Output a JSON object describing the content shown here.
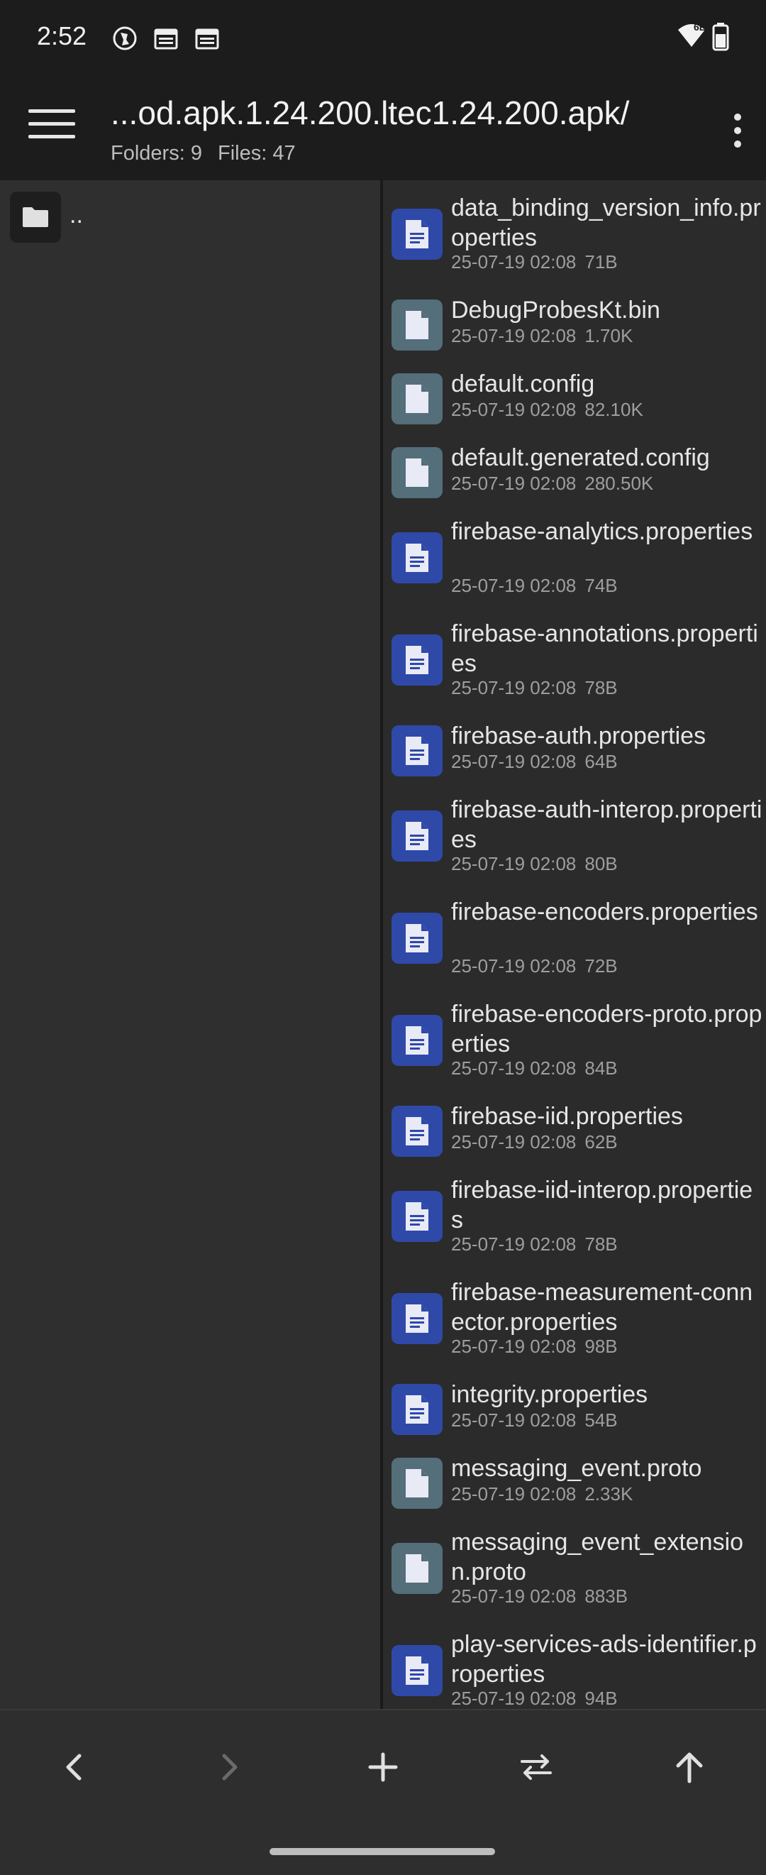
{
  "status_bar": {
    "time": "2:52",
    "icons": [
      "vpn-globe-icon",
      "calendar-icon",
      "calendar-icon"
    ],
    "right_icons": [
      "wifi-icon",
      "battery-icon"
    ],
    "network_label": "6E"
  },
  "app_bar": {
    "title": "...od.apk.1.24.200.ltec1.24.200.apk/",
    "folders_label": "Folders: 9",
    "files_label": "Files: 47"
  },
  "left_pane": {
    "parent_label": ".."
  },
  "files": [
    {
      "name": "data_binding_version_info.properties",
      "date": "25-07-19 02:08",
      "size": "71B",
      "icon": "text-file-icon",
      "color": "#2f49a8"
    },
    {
      "name": "DebugProbesKt.bin",
      "date": "25-07-19 02:08",
      "size": "1.70K",
      "icon": "generic-file-icon",
      "color": "#546e7a"
    },
    {
      "name": "default.config",
      "date": "25-07-19 02:08",
      "size": "82.10K",
      "icon": "generic-file-icon",
      "color": "#546e7a"
    },
    {
      "name": "default.generated.config",
      "date": "25-07-19 02:08",
      "size": "280.50K",
      "icon": "generic-file-icon",
      "color": "#546e7a"
    },
    {
      "name": "firebase-analytics.properties",
      "date": "25-07-19 02:08",
      "size": "74B",
      "icon": "text-file-icon",
      "color": "#2f49a8"
    },
    {
      "name": "firebase-annotations.properties",
      "date": "25-07-19 02:08",
      "size": "78B",
      "icon": "text-file-icon",
      "color": "#2f49a8"
    },
    {
      "name": "firebase-auth.properties",
      "date": "25-07-19 02:08",
      "size": "64B",
      "icon": "text-file-icon",
      "color": "#2f49a8"
    },
    {
      "name": "firebase-auth-interop.properties",
      "date": "25-07-19 02:08",
      "size": "80B",
      "icon": "text-file-icon",
      "color": "#2f49a8"
    },
    {
      "name": "firebase-encoders.properties",
      "date": "25-07-19 02:08",
      "size": "72B",
      "icon": "text-file-icon",
      "color": "#2f49a8"
    },
    {
      "name": "firebase-encoders-proto.properties",
      "date": "25-07-19 02:08",
      "size": "84B",
      "icon": "text-file-icon",
      "color": "#2f49a8"
    },
    {
      "name": "firebase-iid.properties",
      "date": "25-07-19 02:08",
      "size": "62B",
      "icon": "text-file-icon",
      "color": "#2f49a8"
    },
    {
      "name": "firebase-iid-interop.properties",
      "date": "25-07-19 02:08",
      "size": "78B",
      "icon": "text-file-icon",
      "color": "#2f49a8"
    },
    {
      "name": "firebase-measurement-connector.properties",
      "date": "25-07-19 02:08",
      "size": "98B",
      "icon": "text-file-icon",
      "color": "#2f49a8"
    },
    {
      "name": "integrity.properties",
      "date": "25-07-19 02:08",
      "size": "54B",
      "icon": "text-file-icon",
      "color": "#2f49a8"
    },
    {
      "name": "messaging_event.proto",
      "date": "25-07-19 02:08",
      "size": "2.33K",
      "icon": "generic-file-icon",
      "color": "#546e7a"
    },
    {
      "name": "messaging_event_extension.proto",
      "date": "25-07-19 02:08",
      "size": "883B",
      "icon": "generic-file-icon",
      "color": "#546e7a"
    },
    {
      "name": "play-services-ads-identifier.properties",
      "date": "25-07-19 02:08",
      "size": "94B",
      "icon": "text-file-icon",
      "color": "#2f49a8"
    }
  ],
  "bottom_bar": {
    "buttons": [
      "back-arrow-icon",
      "forward-arrow-icon",
      "add-icon",
      "swap-icon",
      "up-arrow-icon"
    ]
  }
}
